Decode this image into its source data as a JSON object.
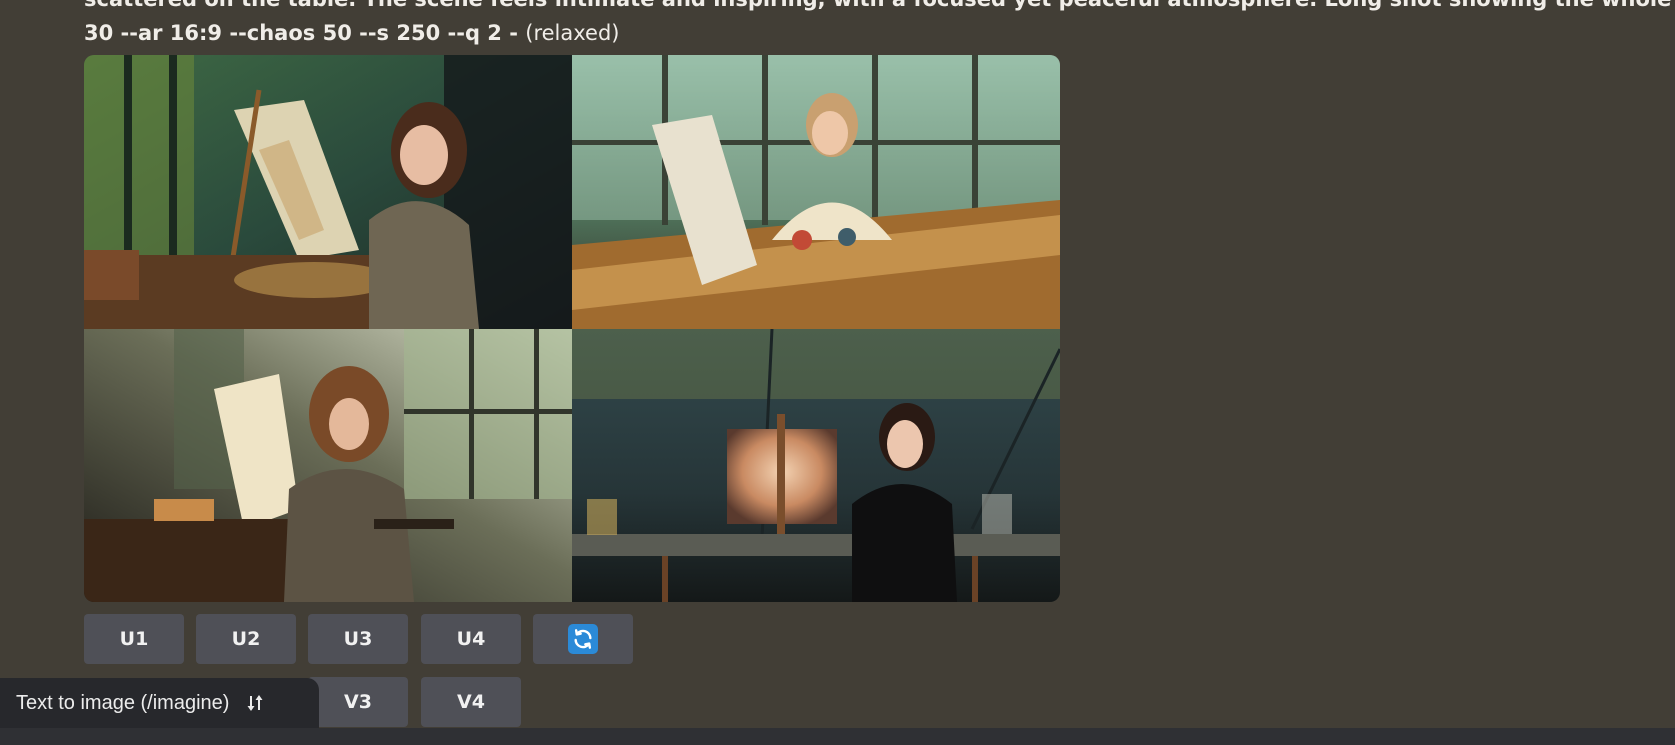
{
  "prompt": {
    "line1": "scattered on the table. The scene feels intimate and inspiring, with a focused yet peaceful atmosphere. Long shot showing the whole room",
    "line2": "30 --ar 16:9 --chaos 50 --s 250 --q 2 -",
    "status": "(relaxed)"
  },
  "images": [
    {
      "name": "image-1",
      "description": "painter seated at easel"
    },
    {
      "name": "image-2",
      "description": "painter at sunlit table"
    },
    {
      "name": "image-3",
      "description": "painter by bright window"
    },
    {
      "name": "image-4",
      "description": "painter with canvas on easel"
    }
  ],
  "upscale_buttons": [
    "U1",
    "U2",
    "U3",
    "U4"
  ],
  "refresh_icon": "refresh-icon",
  "variation_buttons": [
    "V3",
    "V4"
  ],
  "mode": {
    "label": "Text to image (/imagine)",
    "icon": "swap-icon"
  },
  "colors": {
    "background": "#423e36",
    "button": "#4f5057",
    "refresh_accent": "#2b8ad8",
    "mode_pill": "#27282c"
  }
}
